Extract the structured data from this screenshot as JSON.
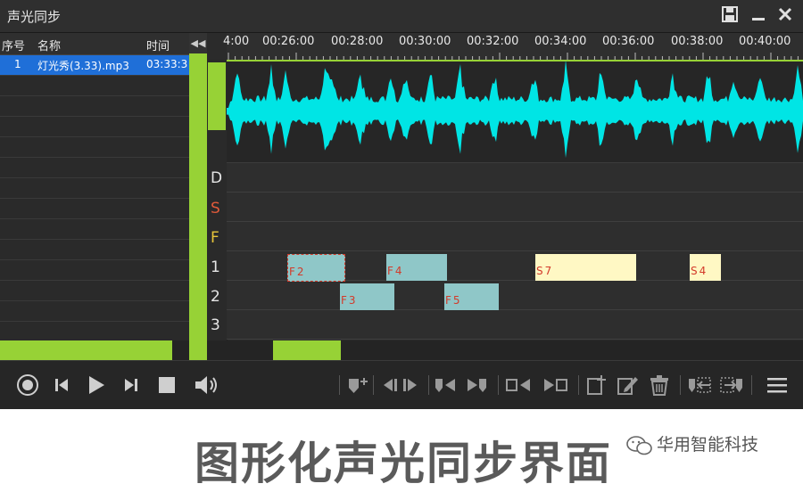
{
  "window": {
    "title": "声光同步"
  },
  "playlist": {
    "headers": {
      "index": "序号",
      "name": "名称",
      "time": "时间"
    },
    "items": [
      {
        "index": "1",
        "name": "灯光秀(3.33).mp3",
        "time": "03:33:3"
      }
    ]
  },
  "timeline": {
    "ticks": [
      "4:00",
      "00:26:00",
      "00:28:00",
      "00:30:00",
      "00:32:00",
      "00:34:00",
      "00:36:00",
      "00:38:00",
      "00:40:00"
    ]
  },
  "tracks": {
    "labels": [
      {
        "text": "D",
        "color": "#e6e6e6"
      },
      {
        "text": "S",
        "color": "#e05a3a"
      },
      {
        "text": "F",
        "color": "#e8c53a"
      },
      {
        "text": "1",
        "color": "#e6e6e6"
      },
      {
        "text": "2",
        "color": "#e6e6e6"
      },
      {
        "text": "3",
        "color": "#e6e6e6"
      }
    ],
    "clips": [
      {
        "label": "F2",
        "track": "1",
        "color": "#8fc7c8"
      },
      {
        "label": "F4",
        "track": "1",
        "color": "#8fc7c8"
      },
      {
        "label": "S7",
        "track": "1",
        "color": "#fff8c4"
      },
      {
        "label": "S4",
        "track": "1",
        "color": "#fff8c4"
      },
      {
        "label": "F3",
        "track": "2",
        "color": "#8fc7c8"
      },
      {
        "label": "F5",
        "track": "2",
        "color": "#8fc7c8"
      }
    ]
  },
  "colors": {
    "accent": "#97d236",
    "waveform": "#00e5e5",
    "selected_row": "#1f6fd8"
  },
  "icons": [
    "save-icon",
    "minimize-icon",
    "close-icon",
    "record-icon",
    "prev-icon",
    "play-icon",
    "next-icon",
    "stop-icon",
    "volume-icon",
    "add-marker-icon",
    "step-back-icon",
    "step-forward-icon",
    "jump-start-icon",
    "jump-end-icon",
    "box-left-icon",
    "box-right-icon",
    "add-item-icon",
    "edit-icon",
    "delete-icon",
    "import-icon",
    "export-icon",
    "menu-icon"
  ],
  "caption": "图形化声光同步界面",
  "brand": "华用智能科技"
}
